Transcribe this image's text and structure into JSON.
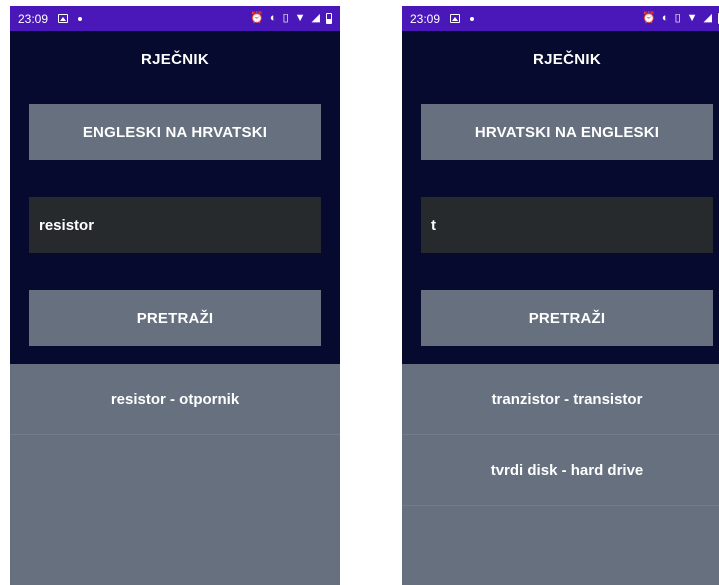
{
  "colors": {
    "statusbar": "#4a17b8",
    "app_background": "#050a2e",
    "button": "#66707f",
    "input": "#262a2d",
    "results_background": "#66707f",
    "text": "#ffffff"
  },
  "left_screen": {
    "status": {
      "time": "23:09",
      "icons": [
        "image-icon",
        "dot-icon",
        "alarm-icon",
        "data-saver-icon",
        "vibrate-icon",
        "wifi-icon",
        "signal-icon",
        "battery-icon"
      ]
    },
    "title": "RJEČNIK",
    "mode_button": "ENGLESKI NA HRVATSKI",
    "input_value": "resistor",
    "search_button": "PRETRAŽI",
    "results": [
      "resistor - otpornik"
    ]
  },
  "right_screen": {
    "status": {
      "time": "23:09",
      "icons": [
        "image-icon",
        "dot-icon",
        "alarm-icon",
        "data-saver-icon",
        "vibrate-icon",
        "wifi-icon",
        "signal-icon",
        "battery-icon"
      ]
    },
    "title": "RJEČNIK",
    "mode_button": "HRVATSKI NA ENGLESKI",
    "input_value": "t",
    "search_button": "PRETRAŽI",
    "results": [
      "tranzistor - transistor",
      "tvrdi disk - hard drive"
    ]
  }
}
